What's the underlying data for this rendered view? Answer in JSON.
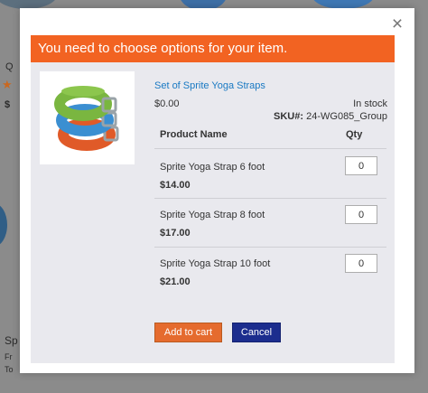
{
  "notice": {
    "text": "You need to choose options for your item."
  },
  "product": {
    "name": "Set of Sprite Yoga Straps",
    "price": "$0.00",
    "stock": "In stock",
    "sku_label": "SKU#:",
    "sku_value": "24-WG085_Group"
  },
  "table": {
    "headers": {
      "name": "Product Name",
      "qty": "Qty"
    },
    "rows": [
      {
        "name": "Sprite Yoga Strap 6 foot",
        "price": "$14.00",
        "qty": "0"
      },
      {
        "name": "Sprite Yoga Strap 8 foot",
        "price": "$17.00",
        "qty": "0"
      },
      {
        "name": "Sprite Yoga Strap 10 foot",
        "price": "$21.00",
        "qty": "0"
      }
    ]
  },
  "buttons": {
    "add_to_cart": "Add to cart",
    "cancel": "Cancel"
  },
  "close": {
    "symbol": "×",
    "icon": "close-icon"
  },
  "background_page": {
    "letter_q": "Q",
    "star": "★",
    "dollar": "$",
    "letter_s": "Sp",
    "letter_f": "Fr",
    "letter_t": "To",
    "letter_b": "B"
  },
  "colors": {
    "notice_bg": "#f26322",
    "link": "#1979c3",
    "add_button": "#e56b2e",
    "cancel_button": "#1c2d8e",
    "strap_green": "#7ab640",
    "strap_blue": "#3b8fd1",
    "strap_orange": "#e05a28"
  }
}
